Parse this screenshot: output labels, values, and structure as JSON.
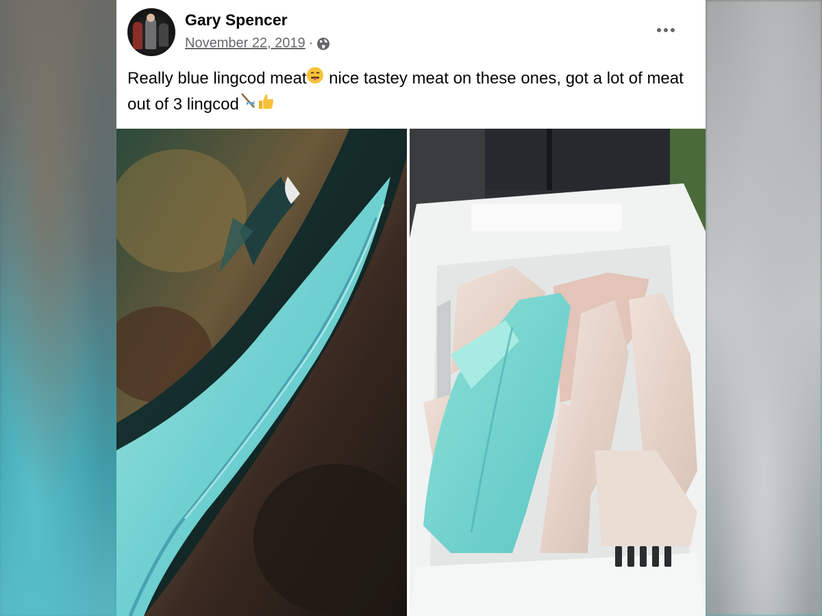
{
  "post": {
    "author": "Gary Spencer",
    "date": "November 22, 2019",
    "separator": "·",
    "caption_part1": "Really blue lingcod meat",
    "caption_part2": " nice tastey meat on these ones, got a lot of meat out of 3 lingcod",
    "icons": {
      "privacy": "globe-icon",
      "options": "more-options-icon",
      "emoji_1": "tongue-out-face-emoji",
      "emoji_2": "fishing-emoji",
      "emoji_3": "thumbs-up-emoji"
    }
  },
  "photos": [
    {
      "name": "blue-lingcod-fillet-photo",
      "subject": "blue lingcod fillet on dark skin"
    },
    {
      "name": "fillets-in-crate-photo",
      "subject": "blue and white fillets in white plastic crate"
    }
  ],
  "colors": {
    "author_text": "#050505",
    "meta_text": "#65676b",
    "post_background": "#ffffff",
    "blue_meat": "#7fd6d6"
  }
}
